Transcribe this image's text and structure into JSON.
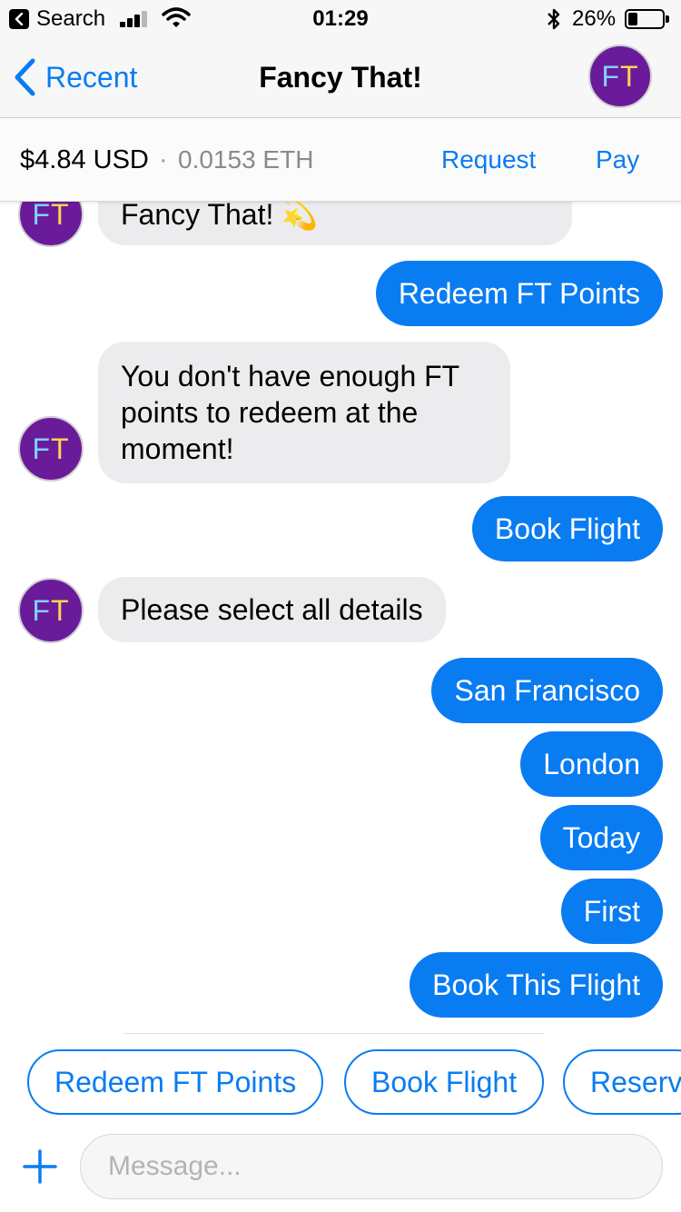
{
  "status_bar": {
    "back_app_label": "Search",
    "time": "01:29",
    "battery_percent": "26%",
    "icons": [
      "back-arrow-icon",
      "signal-bars-icon",
      "wifi-icon",
      "bluetooth-icon",
      "battery-icon"
    ]
  },
  "nav": {
    "back_label": "Recent",
    "title": "Fancy That!",
    "avatar_initials": {
      "first": "F",
      "second": "T"
    }
  },
  "wallet": {
    "usd": "$4.84 USD",
    "separator": "·",
    "eth": "0.0153 ETH",
    "request_label": "Request",
    "pay_label": "Pay"
  },
  "messages": [
    {
      "direction": "in",
      "text": "Fancy That! 💫"
    },
    {
      "direction": "out",
      "text": "Redeem FT Points"
    },
    {
      "direction": "in",
      "text": "You don't have enough FT points to redeem at the moment!"
    },
    {
      "direction": "out",
      "text": "Book Flight"
    },
    {
      "direction": "in",
      "text": "Please select all details"
    },
    {
      "direction": "out",
      "text": "San Francisco"
    },
    {
      "direction": "out",
      "text": "London"
    },
    {
      "direction": "out",
      "text": "Today"
    },
    {
      "direction": "out",
      "text": "First"
    },
    {
      "direction": "out",
      "text": "Book This Flight"
    }
  ],
  "quick_replies": [
    "Redeem FT Points",
    "Book Flight",
    "Reserv"
  ],
  "composer": {
    "placeholder": "Message...",
    "value": ""
  },
  "colors": {
    "accent": "#0a7cf2",
    "incoming_bubble": "#ececee",
    "avatar_bg": "#6a1b9a",
    "avatar_letter_f": "#7fd3ff",
    "avatar_letter_t": "#ffd54f"
  }
}
